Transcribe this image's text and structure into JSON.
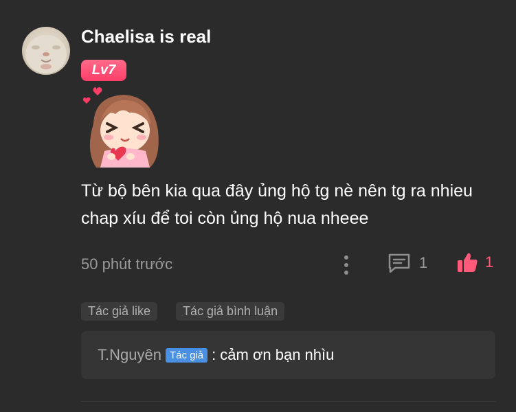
{
  "comment": {
    "username": "Chaelisa is real",
    "level": "Lv7",
    "text": "Từ bộ bên kia qua đây ủng hộ tg nè nên tg ra nhieu chap xíu để toi còn ủng hộ nua nheee",
    "timestamp": "50 phút trước",
    "reply_count": "1",
    "like_count": "1",
    "sticker": "chibi-girl-hearts-sticker"
  },
  "tags": {
    "author_liked": "Tác giả like",
    "author_commented": "Tác giả bình luận"
  },
  "reply": {
    "author": "T.Nguyên",
    "badge": "Tác giả",
    "separator": ":",
    "text": "cảm ơn bạn nhìu"
  },
  "colors": {
    "background": "#2b2b2b",
    "accent_pink": "#ff5a7a",
    "author_badge_blue": "#4a90e2"
  },
  "icons": {
    "more": "more-vertical-icon",
    "reply": "comment-bubble-icon",
    "like": "thumbs-up-icon"
  }
}
